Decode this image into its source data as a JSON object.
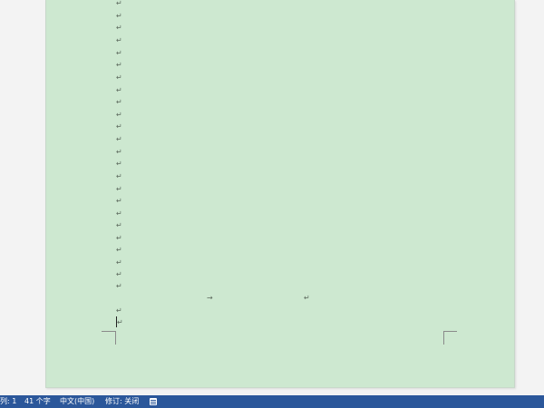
{
  "document": {
    "paragraph_mark": "↵",
    "tab_mark": "→"
  },
  "statusbar": {
    "column": "列: 1",
    "word_count": "41 个字",
    "language": "中文(中国)",
    "track_changes": "修订: 关闭",
    "icon": "macro-record-icon"
  },
  "colors": {
    "page_background": "#cde8d0",
    "statusbar_background": "#2b579a"
  }
}
